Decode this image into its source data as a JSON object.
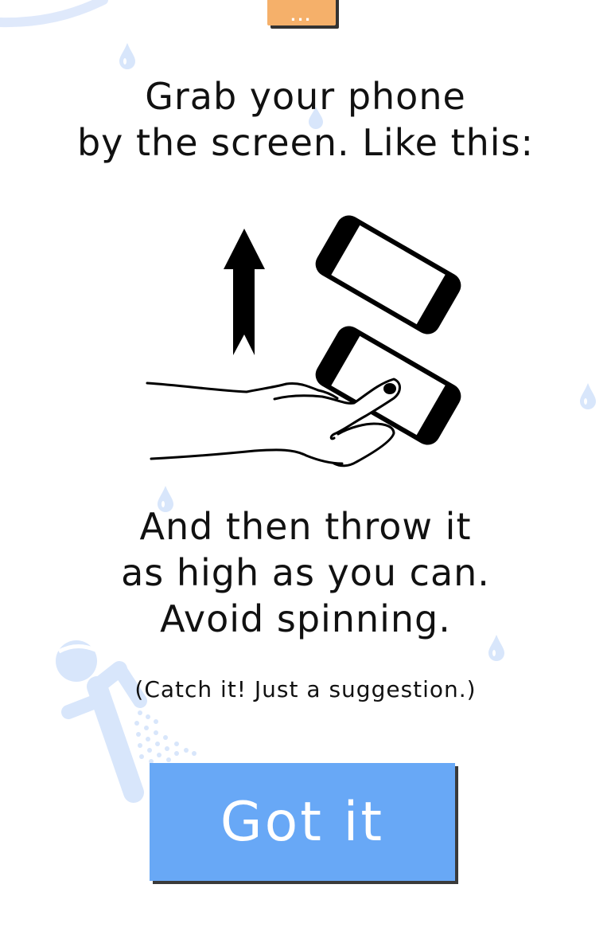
{
  "menu": {
    "label": "...",
    "color": "#f5b06a"
  },
  "title": {
    "line1": "Grab your phone",
    "line2": "by the screen. Like this:"
  },
  "instructions": {
    "line1": "And then throw it",
    "line2": "as high as you can.",
    "line3": "Avoid spinning."
  },
  "note": "(Catch it! Just a suggestion.)",
  "button": {
    "label": "Got it",
    "color": "#68a8f6"
  },
  "decor": {
    "accent": "#d8e6fb",
    "icons": [
      "water-drop-icon",
      "water-drop-icon",
      "water-drop-icon",
      "water-drop-icon",
      "water-drop-icon",
      "water-drop-icon",
      "person-spraying-icon",
      "arc-icon"
    ]
  },
  "illustration": {
    "icons": [
      "up-arrow-icon",
      "phone-icon",
      "hand-holding-phone-icon"
    ]
  }
}
